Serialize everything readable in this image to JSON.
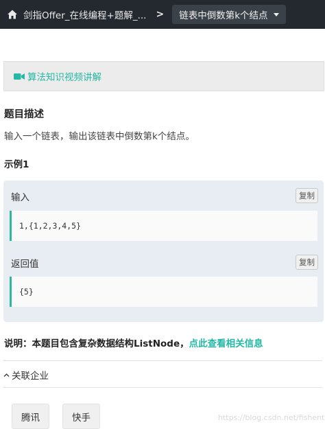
{
  "header": {
    "home_icon": "home-icon",
    "breadcrumb_parent": "剑指Offer_在线编程+题解_...",
    "separator": ">",
    "current_problem": "链表中倒数第k个结点"
  },
  "video": {
    "icon": "video-camera-icon",
    "label": "算法知识视频讲解"
  },
  "description": {
    "title": "题目描述",
    "text": "输入一个链表，输出该链表中倒数第k个结点。"
  },
  "example": {
    "title": "示例1",
    "input_label": "输入",
    "input_value": "1,{1,2,3,4,5}",
    "output_label": "返回值",
    "output_value": "{5}",
    "copy_label": "复制"
  },
  "note": {
    "prefix": "说明：本题目包含复杂数据结构ListNode，",
    "link": "点此查看相关信息"
  },
  "related": {
    "label": "关联企业",
    "companies": [
      "腾讯",
      "快手"
    ]
  },
  "watermark": "https://blog.csdn.net/fishenth",
  "colors": {
    "accent": "#25b8a4",
    "topbar": "#24292f",
    "example_bg": "#e8edf3"
  }
}
